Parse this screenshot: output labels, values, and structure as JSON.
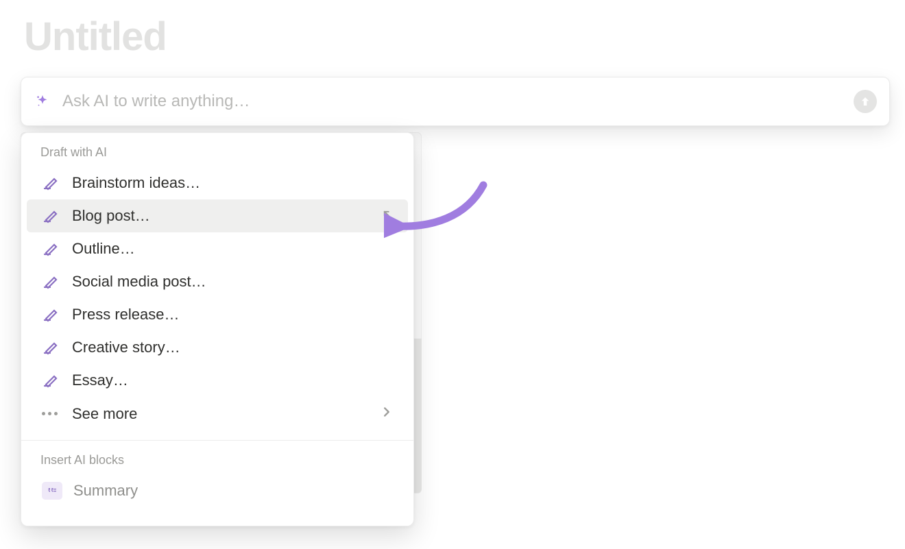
{
  "page_title": "Untitled",
  "ai_input": {
    "placeholder": "Ask AI to write anything…"
  },
  "dropdown": {
    "section1_label": "Draft with AI",
    "items": [
      {
        "label": "Brainstorm ideas…",
        "hover": false
      },
      {
        "label": "Blog post…",
        "hover": true
      },
      {
        "label": "Outline…",
        "hover": false
      },
      {
        "label": "Social media post…",
        "hover": false
      },
      {
        "label": "Press release…",
        "hover": false
      },
      {
        "label": "Creative story…",
        "hover": false
      },
      {
        "label": "Essay…",
        "hover": false
      }
    ],
    "see_more_label": "See more",
    "section2_label": "Insert AI blocks",
    "block_item_label": "Summary"
  },
  "colors": {
    "accent": "#9b7fd4",
    "title_placeholder": "#e2e2e1"
  }
}
